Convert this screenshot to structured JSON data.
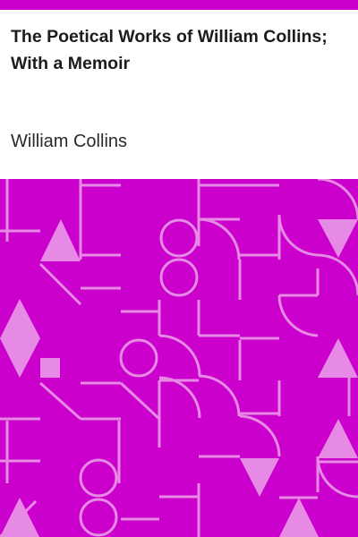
{
  "book": {
    "title": "The Poetical Works of William Collins; With a Memoir",
    "author": "William Collins"
  },
  "colors": {
    "accent": "#cc00cc",
    "pattern_light": "#e68ae6",
    "text": "#1c1c1c",
    "background": "#ffffff"
  }
}
